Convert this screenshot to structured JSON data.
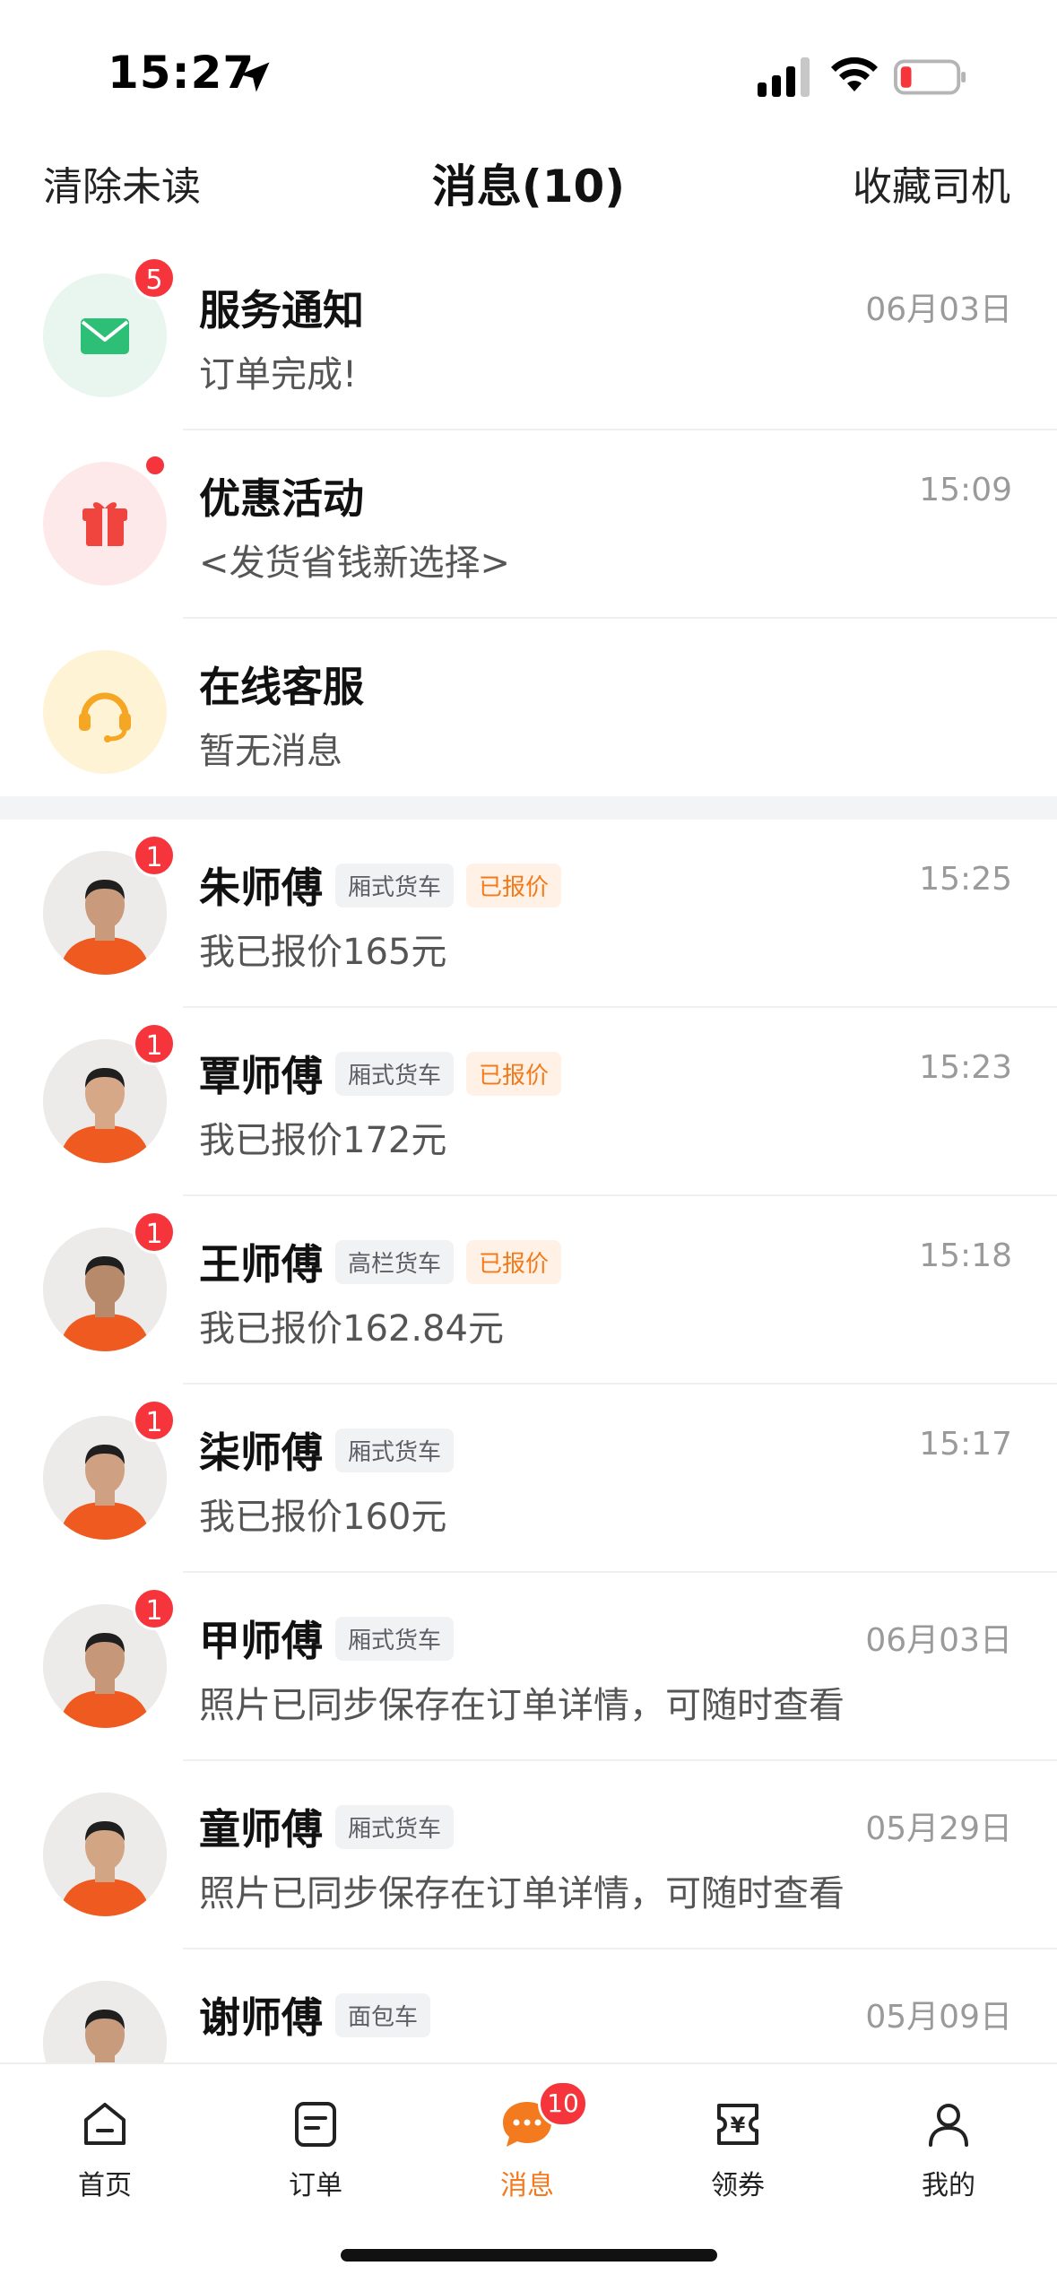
{
  "status_bar": {
    "time": "15:27"
  },
  "nav": {
    "left": "清除未读",
    "title": "消息(10)",
    "right": "收藏司机"
  },
  "system_messages": [
    {
      "title": "服务通知",
      "subtitle": "订单完成!",
      "time": "06月03日",
      "badge": "5",
      "icon": "mail-icon",
      "bg": "#e8f6ef"
    },
    {
      "title": "优惠活动",
      "subtitle": "<发货省钱新选择>",
      "time": "15:09",
      "badge": "",
      "icon": "gift-icon",
      "bg": "#fde9ea"
    },
    {
      "title": "在线客服",
      "subtitle": "暂无消息",
      "time": "",
      "badge": "",
      "icon": "headset-icon",
      "bg": "#fff3d6"
    }
  ],
  "drivers": [
    {
      "name": "朱师傅",
      "vehicle": "厢式货车",
      "status": "已报价",
      "message": "我已报价165元",
      "time": "15:25",
      "badge": "1"
    },
    {
      "name": "覃师傅",
      "vehicle": "厢式货车",
      "status": "已报价",
      "message": "我已报价172元",
      "time": "15:23",
      "badge": "1"
    },
    {
      "name": "王师傅",
      "vehicle": "高栏货车",
      "status": "已报价",
      "message": "我已报价162.84元",
      "time": "15:18",
      "badge": "1"
    },
    {
      "name": "柒师傅",
      "vehicle": "厢式货车",
      "status": "",
      "message": "我已报价160元",
      "time": "15:17",
      "badge": "1"
    },
    {
      "name": "甲师傅",
      "vehicle": "厢式货车",
      "status": "",
      "message": "照片已同步保存在订单详情，可随时查看",
      "time": "06月03日",
      "badge": "1"
    },
    {
      "name": "童师傅",
      "vehicle": "厢式货车",
      "status": "",
      "message": "照片已同步保存在订单详情，可随时查看",
      "time": "05月29日",
      "badge": ""
    },
    {
      "name": "谢师傅",
      "vehicle": "面包车",
      "status": "",
      "message": "",
      "time": "05月09日",
      "badge": ""
    }
  ],
  "tabbar": {
    "tabs": [
      {
        "label": "首页",
        "icon": "home-icon"
      },
      {
        "label": "订单",
        "icon": "order-icon"
      },
      {
        "label": "消息",
        "icon": "message-icon",
        "badge": "10",
        "active": true
      },
      {
        "label": "领券",
        "icon": "coupon-icon"
      },
      {
        "label": "我的",
        "icon": "profile-icon"
      }
    ]
  },
  "colors": {
    "accent": "#f47a1f",
    "badge": "#f5343b",
    "quote_tag_bg": "#fff1e6"
  }
}
